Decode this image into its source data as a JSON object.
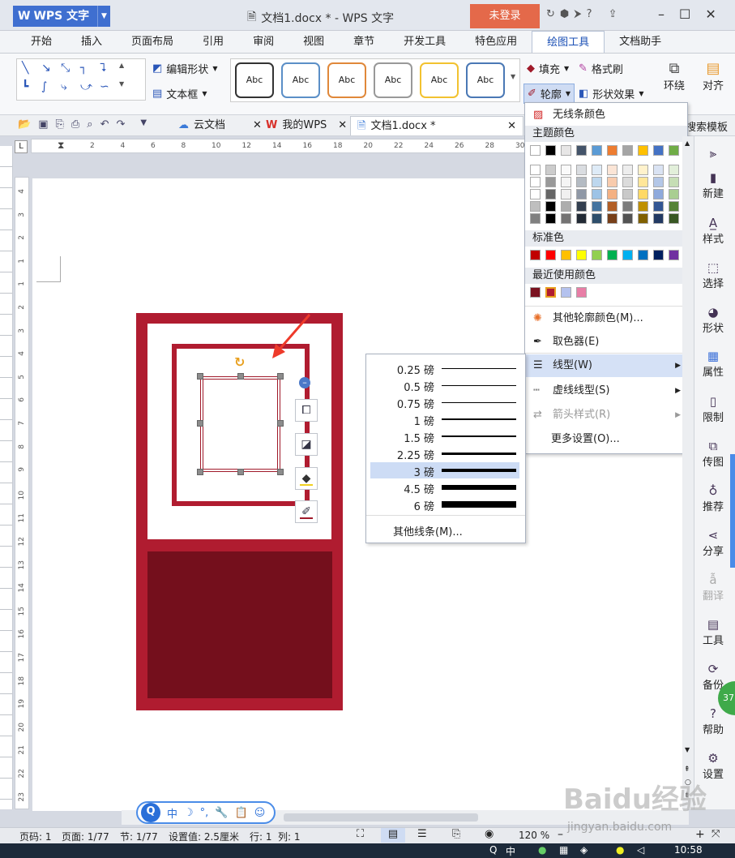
{
  "title_bar": {
    "app_name": "WPS 文字",
    "doc_title": "文档1.docx * - WPS 文字",
    "login_label": "未登录"
  },
  "menu": {
    "tabs": [
      "开始",
      "插入",
      "页面布局",
      "引用",
      "审阅",
      "视图",
      "章节",
      "开发工具",
      "特色应用",
      "绘图工具",
      "文档助手"
    ],
    "active": "绘图工具"
  },
  "ribbon": {
    "edit_shape": "编辑形状",
    "text_box": "文本框",
    "style_label": "Abc",
    "style_colors": [
      "#333333",
      "#5b8fc7",
      "#e0883a",
      "#999999",
      "#f2c230",
      "#4a78b5"
    ],
    "fill": "填充",
    "format_painter": "格式刷",
    "outline": "轮廓",
    "shape_effect": "形状效果",
    "wrap": "环绕",
    "align": "对齐",
    "search_template": "搜索模板"
  },
  "doc_tabs": {
    "cloud_doc": "云文档",
    "my_wps": "我的WPS",
    "doc1": "文档1.docx *"
  },
  "ruler_ticks": [
    "2",
    "4",
    "6",
    "8",
    "10",
    "12",
    "14",
    "16",
    "18",
    "20",
    "22",
    "24",
    "26",
    "28",
    "30"
  ],
  "ruler_v_ticks": [
    "4",
    "3",
    "2",
    "1",
    "1",
    "2",
    "3",
    "4",
    "5",
    "6",
    "7",
    "8",
    "9",
    "10",
    "11",
    "12",
    "13",
    "14",
    "15",
    "16",
    "17",
    "18",
    "19",
    "20",
    "21",
    "22",
    "23"
  ],
  "color_menu": {
    "no_line": "无线条颜色",
    "theme_colors": "主题颜色",
    "standard_colors": "标准色",
    "recent_colors": "最近使用颜色",
    "more_colors": "其他轮廓颜色(M)...",
    "eyedropper": "取色器(E)",
    "line_type": "线型(W)",
    "dash_type": "虚线线型(S)",
    "arrow_style": "箭头样式(R)",
    "more_settings": "更多设置(O)...",
    "theme_row": [
      "#ffffff",
      "#000000",
      "#e7e6e6",
      "#44546a",
      "#5b9bd5",
      "#ed7d31",
      "#a5a5a5",
      "#ffc000",
      "#4472c4",
      "#70ad47"
    ],
    "standard_row": [
      "#c00000",
      "#ff0000",
      "#ffc000",
      "#ffff00",
      "#92d050",
      "#00b050",
      "#00b0f0",
      "#0070c0",
      "#002060",
      "#7030a0"
    ],
    "recent_row": [
      "#7a1220",
      "#b01c30",
      "#b4c2ee",
      "#e87ea6"
    ]
  },
  "line_menu": {
    "unit": "磅",
    "widths": [
      "0.25",
      "0.5",
      "0.75",
      "1",
      "1.5",
      "2.25",
      "3",
      "4.5",
      "6"
    ],
    "selected": "3",
    "more_lines": "其他线条(M)..."
  },
  "sidebar": {
    "items": [
      "新建",
      "样式",
      "选择",
      "形状",
      "属性",
      "限制",
      "传图",
      "推荐",
      "分享",
      "翻译",
      "工具",
      "备份",
      "帮助",
      "设置"
    ]
  },
  "status": {
    "page": "页码: 1",
    "pages": "页面: 1/77",
    "section": "节: 1/77",
    "setting": "设置值: 2.5厘米",
    "row": "行: 1",
    "col": "列: 1",
    "zoom": "120 %"
  },
  "ime": {
    "lang": "中"
  },
  "badge": "37",
  "watermark": "Baidu经验",
  "watermark_url": "jingyan.baidu.com",
  "clock": "10:58"
}
